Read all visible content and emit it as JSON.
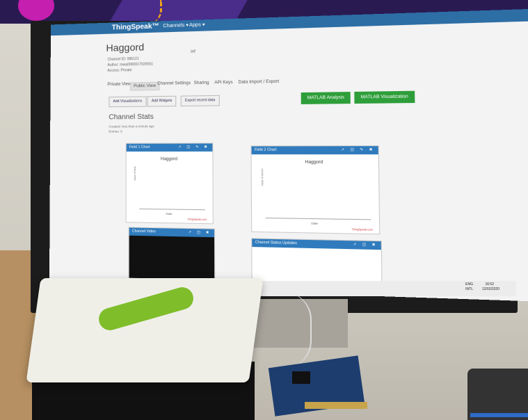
{
  "banner": {
    "accent_circle": "#c41fae",
    "bg": "#2a1a52"
  },
  "thingspeak": {
    "logo": "ThingSpeak™",
    "nav": [
      "Channels ▾",
      "Apps ▾"
    ],
    "channel_title": "Haggord",
    "meta": [
      "Channel ID: 985121",
      "Author: mwa0000017026561",
      "Access: Private"
    ],
    "tag": "inf",
    "tabs": [
      "Private View",
      "Public View",
      "Channel Settings",
      "Sharing",
      "API Keys",
      "Data Import / Export"
    ],
    "buttons": [
      "Add Visualizations",
      "Add Widgets",
      "Export recent data"
    ],
    "green_buttons": [
      "MATLAB Analysis",
      "MATLAB Visualization"
    ],
    "stats_title": "Channel Stats",
    "stats": [
      "Created: less than a minute ago",
      "Entries: 0"
    ],
    "cards": [
      {
        "head": "Field 1 Chart",
        "title": "Haggord",
        "xlabel": "Date",
        "ylabel": "value of field",
        "watermark": "ThingSpeak.com"
      },
      {
        "head": "Field 2 Chart",
        "title": "Haggord",
        "xlabel": "Date",
        "ylabel": "value of sensor",
        "watermark": "ThingSpeak.com"
      },
      {
        "head": "Channel Video"
      },
      {
        "head": "Channel Status Updates"
      }
    ]
  },
  "taskbar": {
    "lang1": "ENG",
    "lang2": "INTL",
    "time": "16:52",
    "date": "12/02/2020"
  }
}
